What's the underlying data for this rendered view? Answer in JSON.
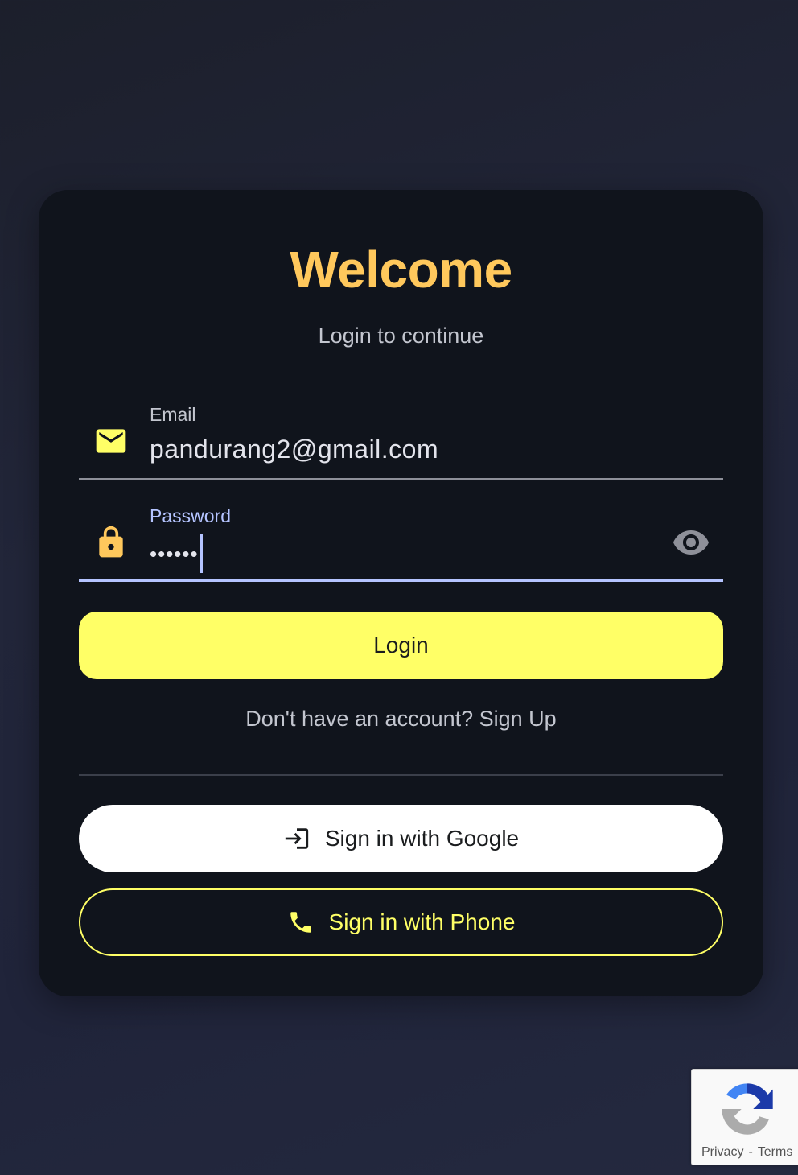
{
  "card": {
    "title": "Welcome",
    "subtitle": "Login to continue"
  },
  "email": {
    "label": "Email",
    "value": "pandurang2@gmail.com",
    "icon": "mail-icon"
  },
  "password": {
    "label": "Password",
    "value": "••••••",
    "icon": "lock-icon",
    "toggle_icon": "eye-icon"
  },
  "buttons": {
    "login": "Login",
    "signup_prompt": "Don't have an account? Sign Up",
    "google": "Sign in with Google",
    "phone": "Sign in with Phone"
  },
  "recaptcha": {
    "privacy": "Privacy",
    "separator": "-",
    "terms": "Terms"
  },
  "colors": {
    "accent_title": "#ffc85c",
    "accent_yellow": "#ffff66",
    "focus_blue": "#b5c4ff",
    "card_bg": "#10141c"
  }
}
